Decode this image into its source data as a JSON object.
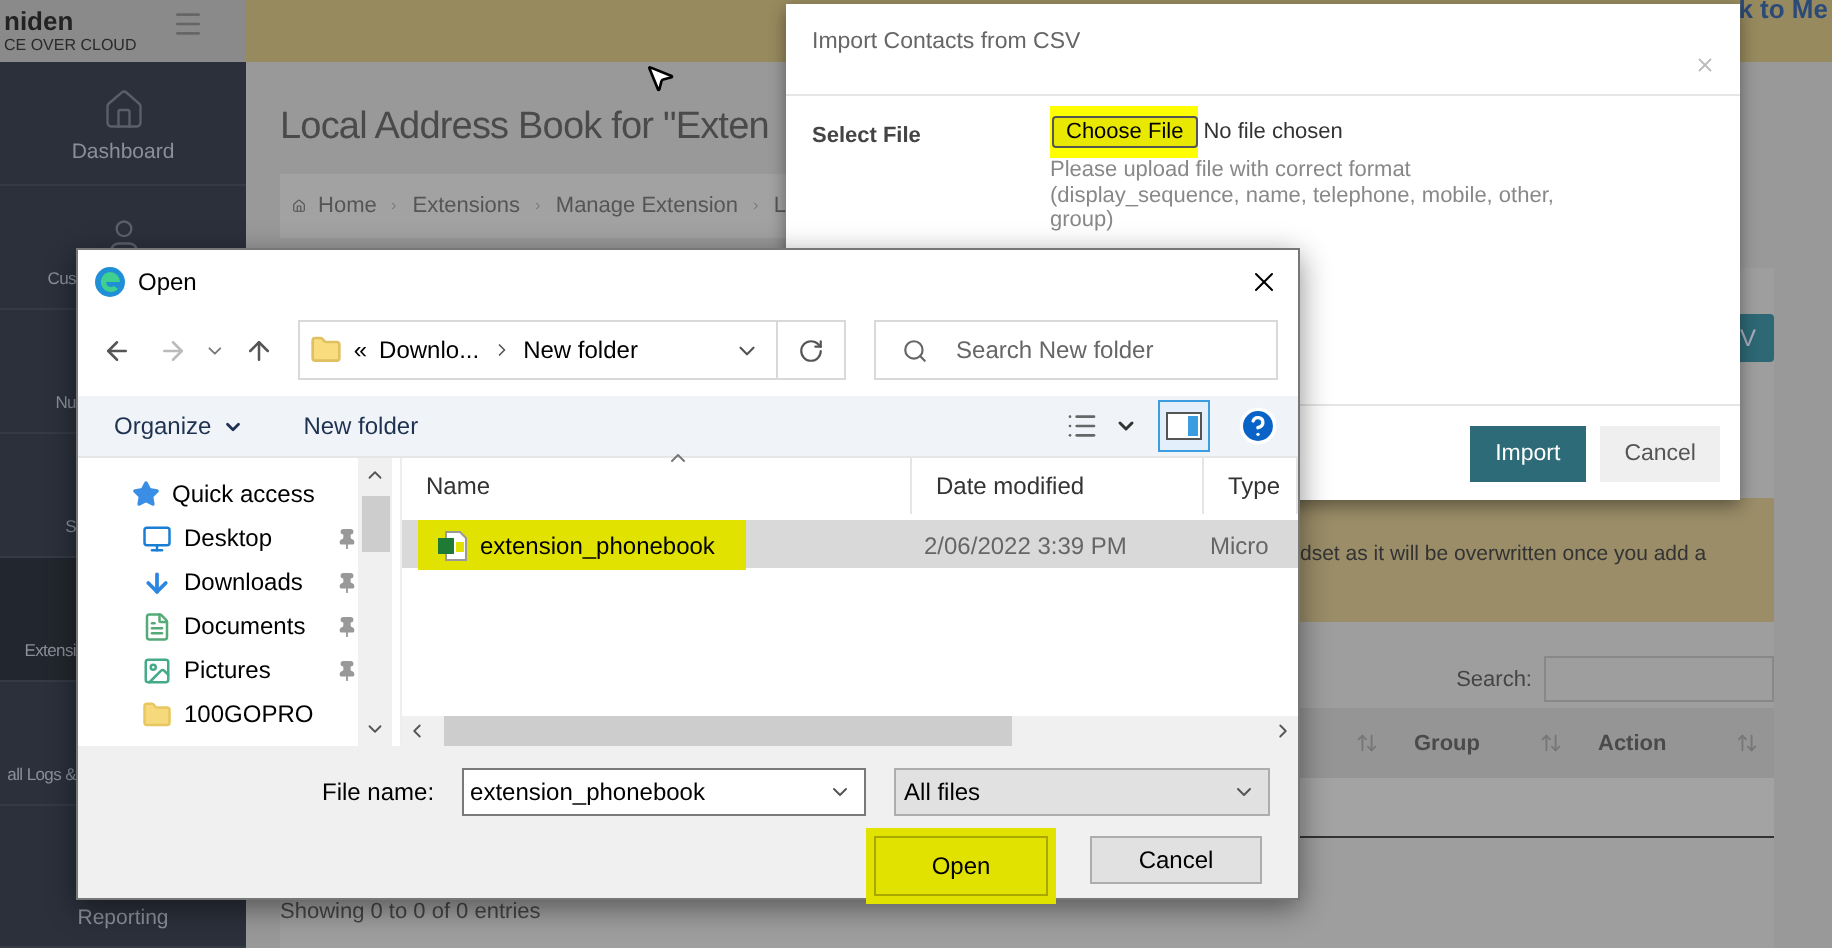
{
  "header": {
    "logo": "niden",
    "tagline": "CE OVER CLOUD",
    "link": "k to Me"
  },
  "sidebar": {
    "items": [
      {
        "label": "Dashboard",
        "selected": false
      },
      {
        "label": "Cus",
        "selected": false
      },
      {
        "label": "Nu",
        "selected": false
      },
      {
        "label": "S",
        "selected": false
      },
      {
        "label": "Extensi",
        "selected": true
      },
      {
        "label": "all Logs &",
        "selected": false
      },
      {
        "label": "Reporting",
        "selected": false
      }
    ]
  },
  "page": {
    "title": "Local Address Book for \"Exten",
    "breadcrumb": [
      "Home",
      "Extensions",
      "Manage Extension",
      "L"
    ],
    "action_button": "V",
    "alert": "dset as it will be overwritten once you add a",
    "search_label": "Search:",
    "columns": [
      "Group",
      "Action"
    ],
    "footer": "Showing 0 to 0 of 0 entries"
  },
  "import_modal": {
    "title": "Import Contacts from CSV",
    "field_label": "Select File",
    "choose_label": "Choose File",
    "choose_highlighted": true,
    "file_status": "No file chosen",
    "hint": "Please upload file with correct format (display_sequence, name, telephone, mobile, other, group)",
    "buttons": [
      {
        "label": "Import",
        "kind": "primary"
      },
      {
        "label": "Cancel",
        "kind": "secondary"
      }
    ]
  },
  "open_dialog": {
    "title": "Open",
    "path_overflow": "«",
    "path": [
      "Downlo...",
      "New folder"
    ],
    "search_placeholder": "Search New folder",
    "organize": "Organize",
    "new_folder": "New folder",
    "preview_pane_on": true,
    "nav_items": [
      {
        "label": "Quick access",
        "pinned": false
      },
      {
        "label": "Desktop",
        "pinned": true
      },
      {
        "label": "Downloads",
        "pinned": true
      },
      {
        "label": "Documents",
        "pinned": true
      },
      {
        "label": "Pictures",
        "pinned": true
      },
      {
        "label": "100GOPRO",
        "pinned": false
      }
    ],
    "columns": [
      "Name",
      "Date modified",
      "Type"
    ],
    "files": [
      {
        "name": "extension_phonebook",
        "date": "2/06/2022 3:39 PM",
        "type": "Micro",
        "selected": true,
        "highlighted": true
      }
    ],
    "file_name_label": "File name:",
    "file_name": "extension_phonebook",
    "filter": "All files",
    "buttons": [
      {
        "label": "Open",
        "highlighted": true
      },
      {
        "label": "Cancel",
        "highlighted": false
      }
    ]
  }
}
